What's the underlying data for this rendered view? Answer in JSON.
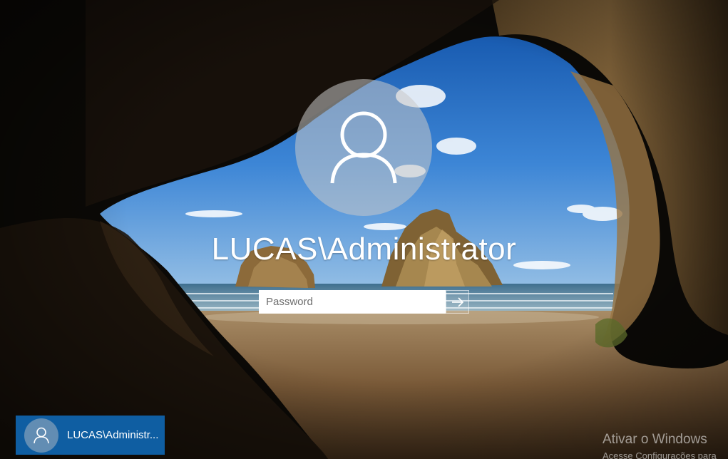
{
  "user": {
    "display_name": "LUCAS\\Administrator",
    "tile_name": "LUCAS\\Administr..."
  },
  "password": {
    "placeholder": "Password",
    "value": ""
  },
  "icons": {
    "avatar": "user-silhouette-icon",
    "submit": "arrow-right-icon"
  },
  "watermark": {
    "title": "Ativar o Windows",
    "subtitle": "Acesse Configurações para"
  },
  "colors": {
    "tile_accent": "#0f5ea2",
    "avatar_circle": "#c8c8c8"
  }
}
